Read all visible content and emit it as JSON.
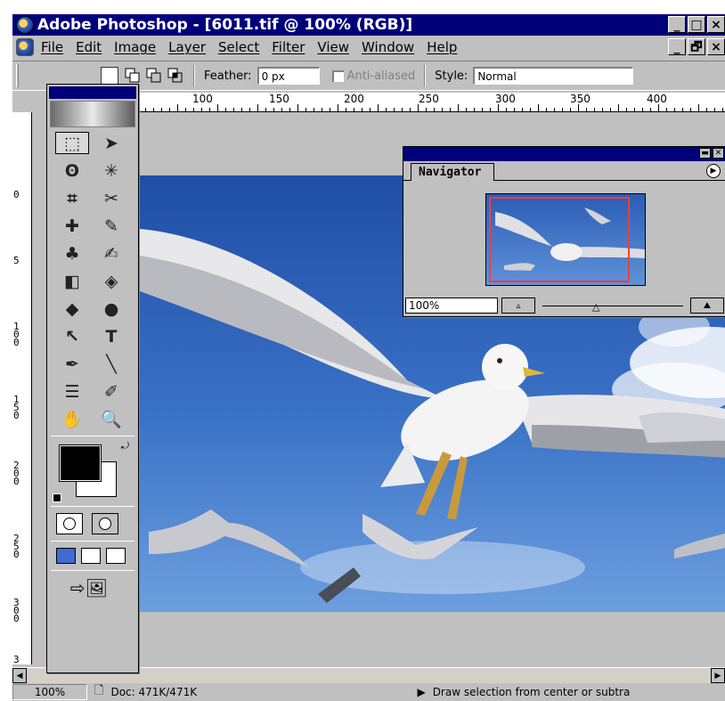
{
  "window": {
    "title": "Adobe Photoshop - [6011.tif @ 100% (RGB)]",
    "buttons": [
      "_",
      "□",
      "×"
    ]
  },
  "menu": {
    "items": [
      "File",
      "Edit",
      "Image",
      "Layer",
      "Select",
      "Filter",
      "View",
      "Window",
      "Help"
    ],
    "doc_buttons": [
      "_",
      "🗗",
      "×"
    ]
  },
  "options": {
    "feather_label": "Feather:",
    "feather_value": "0 px",
    "antialiased_label": "Anti-aliased",
    "style_label": "Style:",
    "style_value": "Normal"
  },
  "ruler": {
    "top_labels": [
      "100",
      "150",
      "200",
      "250",
      "300",
      "350",
      "400"
    ],
    "left_labels": [
      "0",
      "5",
      "100",
      "150",
      "200",
      "250",
      "300",
      "3"
    ]
  },
  "toolbox": {
    "tools": [
      {
        "name": "marquee-tool",
        "glyph": "⬚"
      },
      {
        "name": "move-tool",
        "glyph": "➤"
      },
      {
        "name": "lasso-tool",
        "glyph": "ʘ"
      },
      {
        "name": "magic-wand-tool",
        "glyph": "✳"
      },
      {
        "name": "crop-tool",
        "glyph": "⌗"
      },
      {
        "name": "slice-tool",
        "glyph": "✂"
      },
      {
        "name": "healing-tool",
        "glyph": "✚"
      },
      {
        "name": "brush-tool",
        "glyph": "✎"
      },
      {
        "name": "stamp-tool",
        "glyph": "♣"
      },
      {
        "name": "history-brush-tool",
        "glyph": "✍"
      },
      {
        "name": "eraser-tool",
        "glyph": "◧"
      },
      {
        "name": "bucket-tool",
        "glyph": "◈"
      },
      {
        "name": "blur-tool",
        "glyph": "◆"
      },
      {
        "name": "dodge-tool",
        "glyph": "●"
      },
      {
        "name": "path-select-tool",
        "glyph": "↖"
      },
      {
        "name": "type-tool",
        "glyph": "T"
      },
      {
        "name": "pen-tool",
        "glyph": "✒"
      },
      {
        "name": "line-tool",
        "glyph": "╲"
      },
      {
        "name": "notes-tool",
        "glyph": "☰"
      },
      {
        "name": "eyedropper-tool",
        "glyph": "✐"
      },
      {
        "name": "hand-tool",
        "glyph": "✋"
      },
      {
        "name": "zoom-tool",
        "glyph": "🔍"
      }
    ]
  },
  "navigator": {
    "title": "Navigator",
    "zoom_value": "100%",
    "zoom_out_glyph": "▵",
    "zoom_in_glyph": "⛰"
  },
  "status": {
    "zoom": "100%",
    "doc": "Doc: 471K/471K",
    "message": "Draw selection from center or subtra"
  },
  "colors": {
    "titlebar": "#00007b",
    "chrome": "#c0c0c0",
    "sky": "#3a72c6",
    "nav_view_box": "#ff3b3b"
  }
}
